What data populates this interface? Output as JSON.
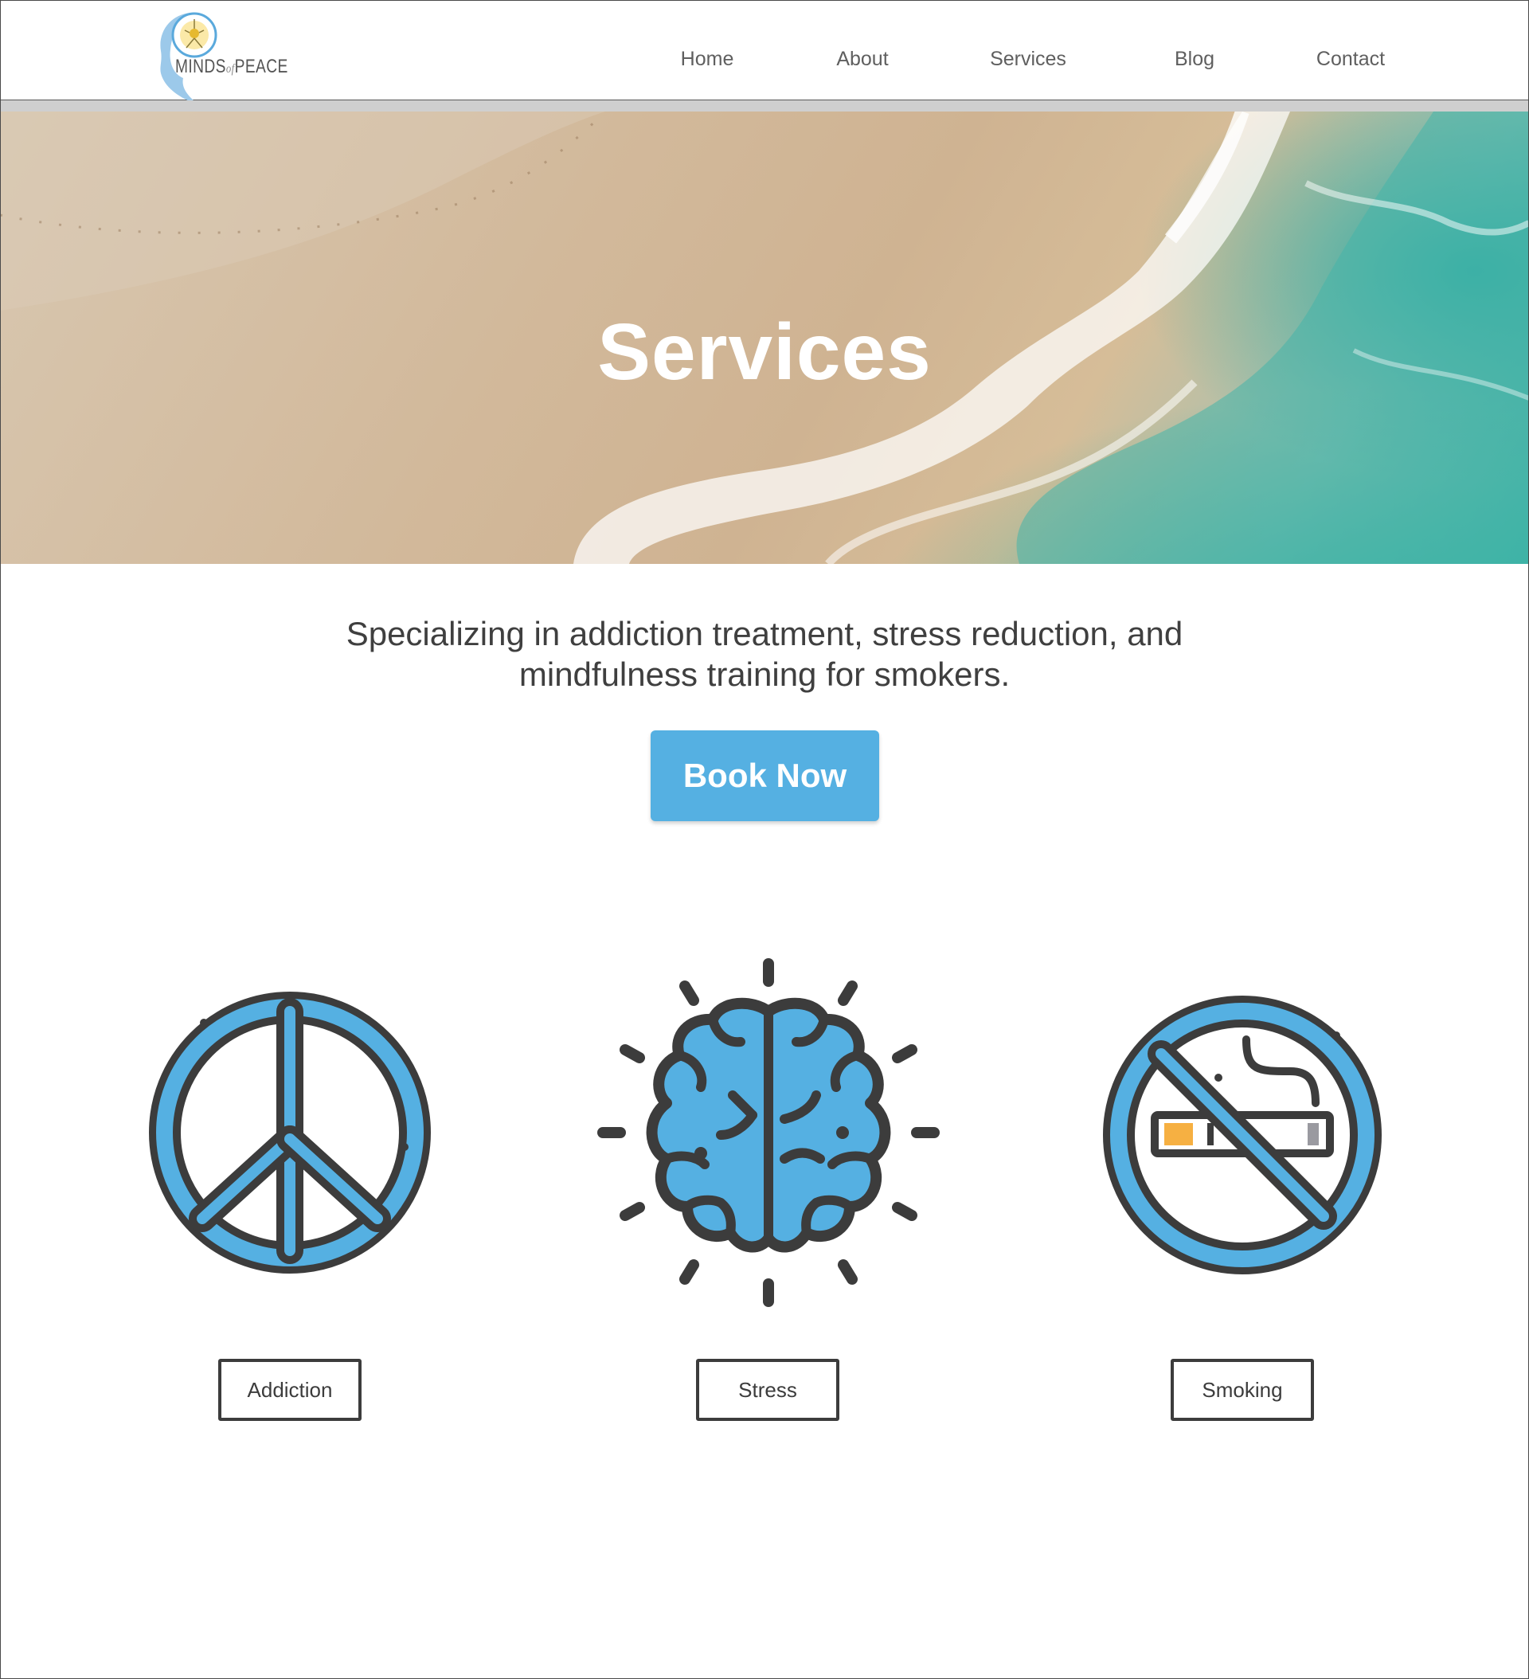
{
  "brand": {
    "logo_text_left": "MINDS",
    "logo_text_mid": "of",
    "logo_text_right": "PEACE"
  },
  "nav": {
    "items": [
      "Home",
      "About",
      "Services",
      "Blog",
      "Contact"
    ]
  },
  "hero": {
    "title": "Services"
  },
  "intro": {
    "line1": "Specializing in addiction treatment, stress reduction, and",
    "line2": "mindfulness training for smokers."
  },
  "cta": {
    "label": "Book Now"
  },
  "services": [
    {
      "label": "Addiction",
      "icon": "peace-sign-icon"
    },
    {
      "label": "Stress",
      "icon": "brain-icon"
    },
    {
      "label": "Smoking",
      "icon": "no-smoking-icon"
    }
  ],
  "colors": {
    "accent": "#55b0e2",
    "icon_outline": "#3c3c3c",
    "cigarette_tip": "#f6b042",
    "cigarette_filter": "#9a9aa0",
    "text": "#3f3f3f"
  }
}
